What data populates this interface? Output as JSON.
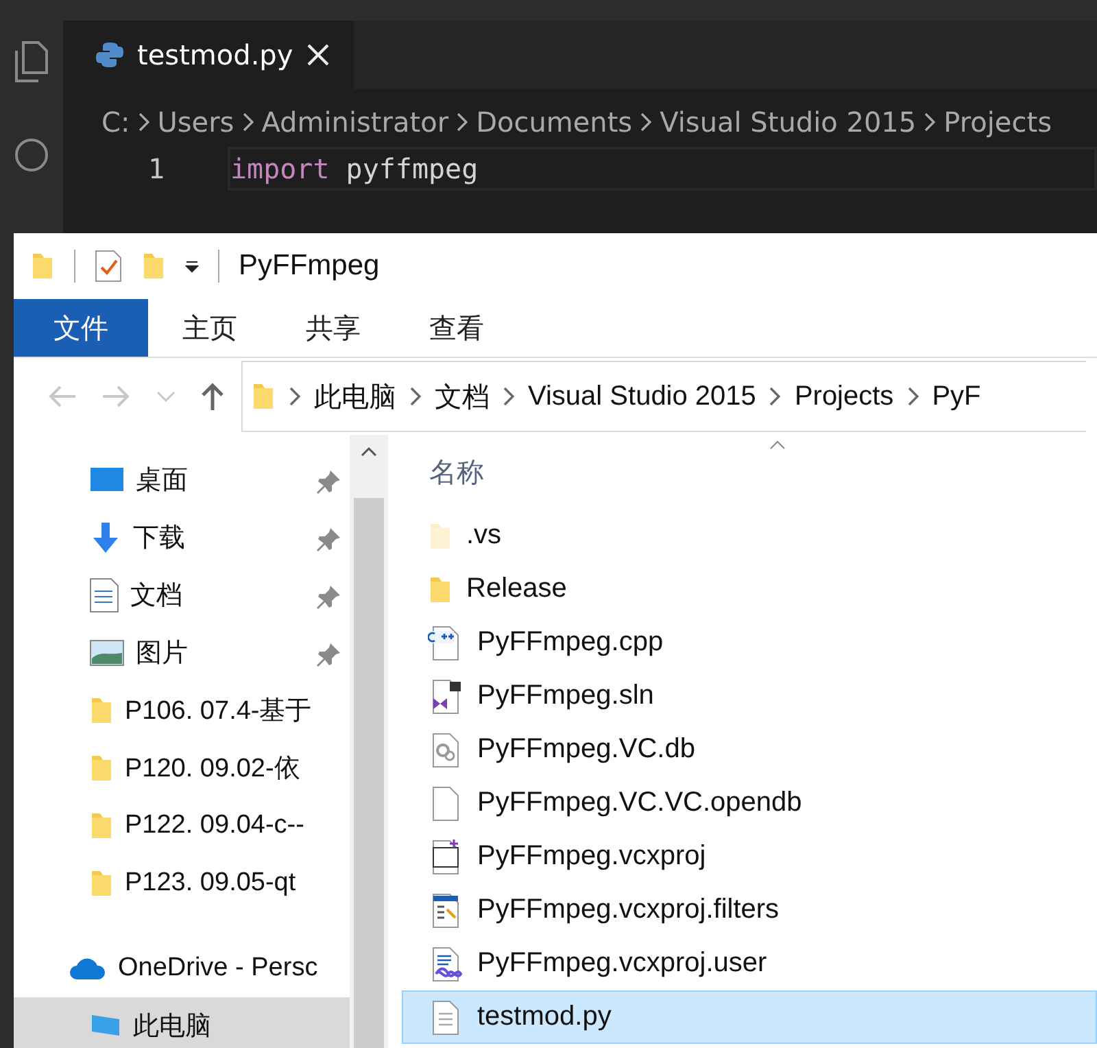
{
  "editor": {
    "tab": {
      "title": "testmod.py"
    },
    "breadcrumb": [
      "C:",
      "Users",
      "Administrator",
      "Documents",
      "Visual Studio 2015",
      "Projects"
    ],
    "lines": [
      {
        "number": "1",
        "tokens": [
          {
            "text": "import",
            "kind": "keyword"
          },
          {
            "text": "pyffmpeg",
            "kind": "name"
          }
        ]
      }
    ]
  },
  "explorer": {
    "title": "PyFFmpeg",
    "ribbon_tabs": [
      {
        "label": "文件",
        "selected": true
      },
      {
        "label": "主页",
        "selected": false
      },
      {
        "label": "共享",
        "selected": false
      },
      {
        "label": "查看",
        "selected": false
      }
    ],
    "address": [
      "此电脑",
      "文档",
      "Visual Studio 2015",
      "Projects",
      "PyF"
    ],
    "nav": [
      {
        "label": "桌面",
        "kind": "desktop",
        "pinned": true,
        "selected": false
      },
      {
        "label": "下载",
        "kind": "download",
        "pinned": true,
        "selected": false
      },
      {
        "label": "文档",
        "kind": "documents",
        "pinned": true,
        "selected": false
      },
      {
        "label": "图片",
        "kind": "pictures",
        "pinned": true,
        "selected": false
      },
      {
        "label": "P106. 07.4-基于",
        "kind": "folder",
        "pinned": false,
        "selected": false
      },
      {
        "label": "P120. 09.02-依",
        "kind": "folder",
        "pinned": false,
        "selected": false
      },
      {
        "label": "P122. 09.04-c--",
        "kind": "folder",
        "pinned": false,
        "selected": false
      },
      {
        "label": "P123. 09.05-qt",
        "kind": "folder",
        "pinned": false,
        "selected": false
      },
      {
        "label": "OneDrive - Persc",
        "kind": "onedrive",
        "pinned": false,
        "selected": false
      },
      {
        "label": "此电脑",
        "kind": "pc",
        "pinned": false,
        "selected": true
      }
    ],
    "column_header": "名称",
    "files": [
      {
        "name": ".vs",
        "kind": "folder-faded",
        "selected": false
      },
      {
        "name": "Release",
        "kind": "folder",
        "selected": false
      },
      {
        "name": "PyFFmpeg.cpp",
        "kind": "cpp",
        "selected": false
      },
      {
        "name": "PyFFmpeg.sln",
        "kind": "sln",
        "selected": false
      },
      {
        "name": "PyFFmpeg.VC.db",
        "kind": "db",
        "selected": false
      },
      {
        "name": "PyFFmpeg.VC.VC.opendb",
        "kind": "blank",
        "selected": false
      },
      {
        "name": "PyFFmpeg.vcxproj",
        "kind": "vcxproj",
        "selected": false
      },
      {
        "name": "PyFFmpeg.vcxproj.filters",
        "kind": "filters",
        "selected": false
      },
      {
        "name": "PyFFmpeg.vcxproj.user",
        "kind": "user",
        "selected": false
      },
      {
        "name": "testmod.py",
        "kind": "text",
        "selected": true
      }
    ]
  }
}
